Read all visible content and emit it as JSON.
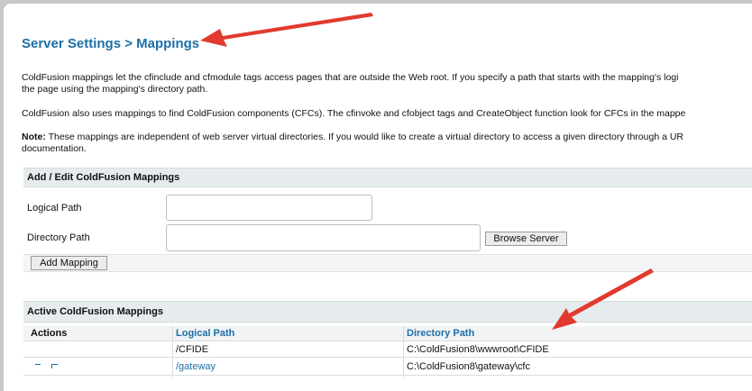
{
  "page": {
    "title": "Server Settings > Mappings",
    "intro1": "ColdFusion mappings let the cfinclude and cfmodule tags access pages that are outside the Web root. If you specify a path that starts with the mapping's logi",
    "intro1b": "the page using the mapping's directory path.",
    "intro2": "ColdFusion also uses mappings to find ColdFusion components (CFCs). The cfinvoke and cfobject tags and CreateObject function look for CFCs in the mappe",
    "note_label": "Note:",
    "note_text": " These mappings are independent of web server virtual directories. If you would like to create a virtual directory to access a given directory through a UR",
    "note_text2": "documentation."
  },
  "add_edit": {
    "header": "Add / Edit ColdFusion Mappings",
    "logical_path_label": "Logical Path",
    "logical_path_value": "",
    "directory_path_label": "Directory Path",
    "directory_path_value": "",
    "browse_button": "Browse Server",
    "add_button": "Add Mapping"
  },
  "active": {
    "header": "Active ColdFusion Mappings",
    "columns": [
      "Actions",
      "Logical Path",
      "Directory Path"
    ],
    "rows": [
      {
        "actions": "",
        "logical_path": "/CFIDE",
        "directory_path": "C:\\ColdFusion8\\wwwroot\\CFIDE"
      },
      {
        "actions": "edit-delete-icons",
        "logical_path": "/gateway",
        "directory_path": "C:\\ColdFusion8\\gateway\\cfc"
      }
    ]
  },
  "annotations": {
    "arrow_color": "#e23a2e"
  },
  "colors": {
    "title": "#1c6fa8",
    "link": "#1c6fa8",
    "section_bar": "#e6ebee"
  }
}
